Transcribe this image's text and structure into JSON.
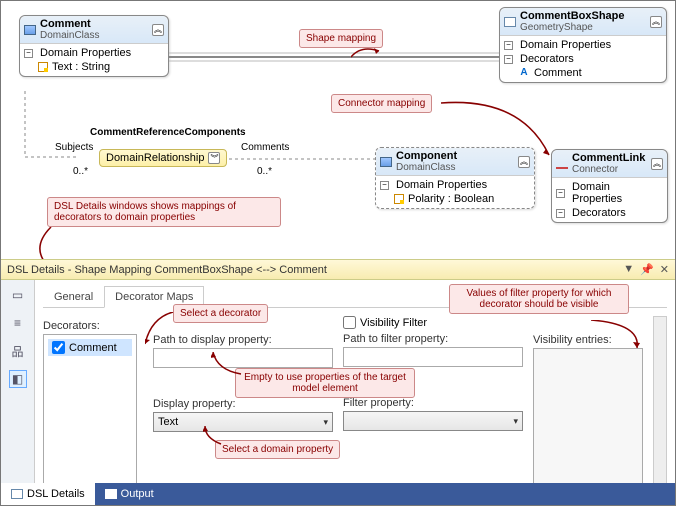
{
  "canvas": {
    "comment": {
      "name": "Comment",
      "kind": "DomainClass",
      "sec": "Domain Properties",
      "prop": "Text : String"
    },
    "component": {
      "name": "Component",
      "kind": "DomainClass",
      "sec": "Domain Properties",
      "prop": "Polarity : Boolean"
    },
    "shape": {
      "name": "CommentBoxShape",
      "kind": "GeometryShape",
      "sec1": "Domain Properties",
      "sec2": "Decorators",
      "dec": "Comment"
    },
    "link": {
      "name": "CommentLink",
      "kind": "Connector",
      "sec1": "Domain Properties",
      "sec2": "Decorators"
    },
    "rel": {
      "title": "CommentReferenceComponents",
      "role1": "Subjects",
      "card1": "0..*",
      "mid": "DomainRelationship",
      "role2": "Comments",
      "card2": "0..*"
    },
    "callouts": {
      "shapemap": "Shape mapping",
      "connmap": "Connector mapping",
      "dsl": "DSL Details windows shows mappings of decorators to domain properties"
    }
  },
  "bar": {
    "title": "DSL Details - Shape Mapping CommentBoxShape <--> Comment"
  },
  "details": {
    "tabs": {
      "general": "General",
      "decmaps": "Decorator Maps"
    },
    "decorators_label": "Decorators:",
    "dec_item": "Comment",
    "path_display": "Path to display property:",
    "display_prop": "Display property:",
    "display_val": "Text",
    "vis_filter": "Visibility Filter",
    "path_filter": "Path to filter property:",
    "filter_prop": "Filter property:",
    "vis_entries": "Visibility entries:",
    "callouts": {
      "seldec": "Select a decorator",
      "empty": "Empty to use properties of the target model element",
      "seldom": "Select a domain property",
      "visval": "Values of filter property for which decorator should be visible"
    }
  },
  "bottom": {
    "dsl": "DSL Details",
    "out": "Output"
  }
}
